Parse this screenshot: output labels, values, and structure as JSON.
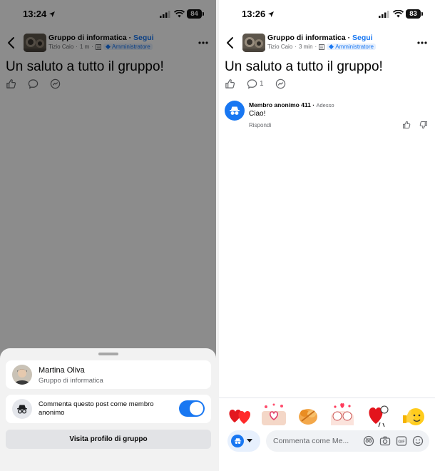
{
  "left": {
    "status": {
      "time": "13:24",
      "battery": "84"
    },
    "header": {
      "group_name": "Gruppo di informatica",
      "separator": " · ",
      "follow": "Segui",
      "author": "Tizio Caio",
      "time_ago": "1 m",
      "admin": "Amministratore"
    },
    "post": {
      "text": "Un saluto a tutto il gruppo!"
    },
    "sheet": {
      "profile_name": "Martina Oliva",
      "profile_sub": "Gruppo di informatica",
      "anon_label": "Commenta questo post come membro anonimo",
      "anon_toggle": "on",
      "visit_button": "Visita profilo di gruppo"
    }
  },
  "right": {
    "status": {
      "time": "13:26",
      "battery": "83"
    },
    "header": {
      "group_name": "Gruppo di informatica",
      "separator": " · ",
      "follow": "Segui",
      "author": "Tizio Caio",
      "time_ago": "3 min",
      "admin": "Amministratore"
    },
    "post": {
      "text": "Un saluto a tutto il gruppo!",
      "comment_count": "1"
    },
    "comment": {
      "author": "Membro anonimo 411",
      "time": "Adesso",
      "text": "Ciao!",
      "reply": "Rispondi"
    },
    "stickers": [
      "hearts-sticker",
      "heart-hands-sticker",
      "hug-sticker",
      "cats-love-sticker",
      "heart-character-sticker",
      "thumbs-up-emoji-sticker"
    ],
    "composer": {
      "placeholder": "Commenta come Me..."
    }
  },
  "colors": {
    "accent": "#1877f2",
    "overlay": "rgba(0,0,0,0.45)"
  }
}
